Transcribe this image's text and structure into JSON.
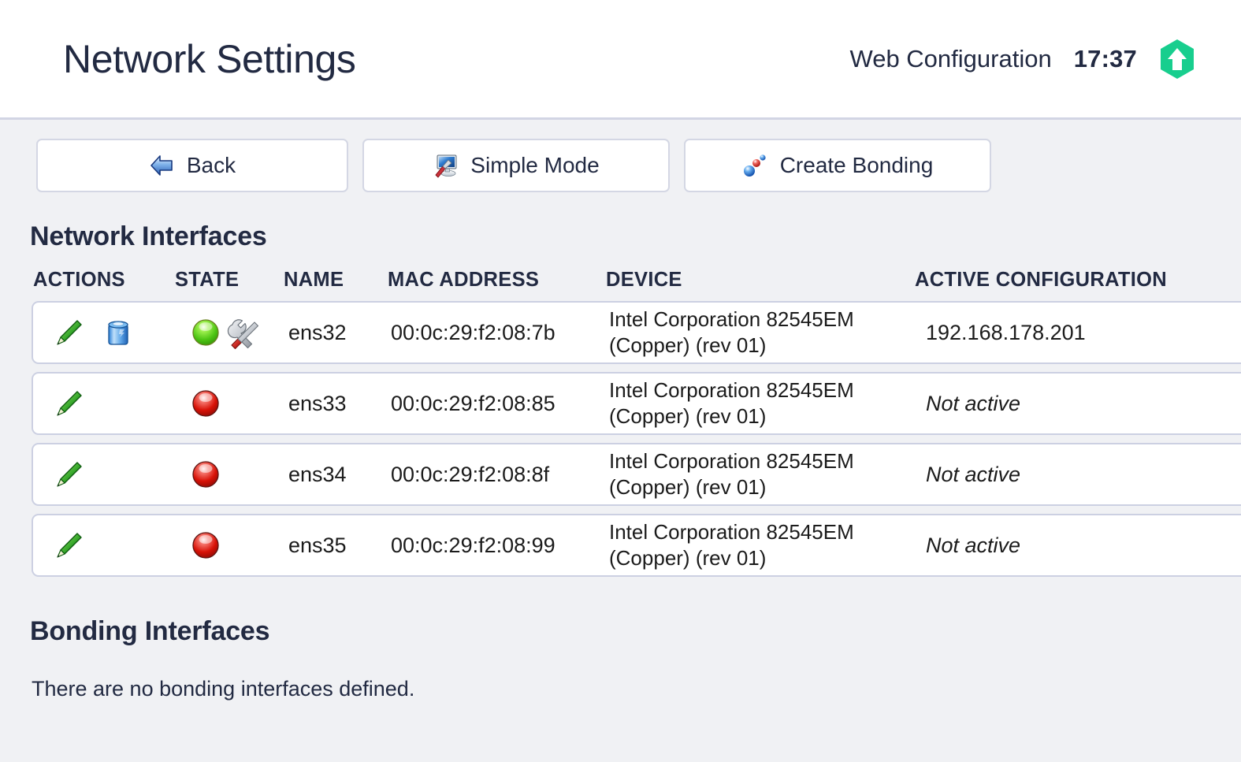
{
  "header": {
    "title": "Network Settings",
    "section": "Web Configuration",
    "clock": "17:37",
    "logo_color": "#18ce8e",
    "logo_icon": "hexagon-up-arrow-logo"
  },
  "toolbar": {
    "buttons": [
      {
        "label": "Back",
        "icon": "back-arrow-icon"
      },
      {
        "label": "Simple Mode",
        "icon": "monitor-screwdriver-icon"
      },
      {
        "label": "Create Bonding",
        "icon": "bonding-spheres-icon"
      }
    ]
  },
  "interfaces_section": {
    "heading": "Network Interfaces",
    "columns": [
      "ACTIONS",
      "STATE",
      "NAME",
      "MAC ADDRESS",
      "DEVICE",
      "ACTIVE CONFIGURATION"
    ],
    "rows": [
      {
        "actions": [
          "edit-pencil-icon",
          "delete-trash-icon"
        ],
        "state": "up",
        "state_icons": [
          "green-led-icon",
          "tools-icon"
        ],
        "name": "ens32",
        "mac": "00:0c:29:f2:08:7b",
        "device": "Intel Corporation 82545EM (Copper) (rev 01)",
        "config": "192.168.178.201",
        "config_active": true
      },
      {
        "actions": [
          "edit-pencil-icon"
        ],
        "state": "down",
        "state_icons": [
          "red-led-icon"
        ],
        "name": "ens33",
        "mac": "00:0c:29:f2:08:85",
        "device": "Intel Corporation 82545EM (Copper) (rev 01)",
        "config": "Not active",
        "config_active": false
      },
      {
        "actions": [
          "edit-pencil-icon"
        ],
        "state": "down",
        "state_icons": [
          "red-led-icon"
        ],
        "name": "ens34",
        "mac": "00:0c:29:f2:08:8f",
        "device": "Intel Corporation 82545EM (Copper) (rev 01)",
        "config": "Not active",
        "config_active": false
      },
      {
        "actions": [
          "edit-pencil-icon"
        ],
        "state": "down",
        "state_icons": [
          "red-led-icon"
        ],
        "name": "ens35",
        "mac": "00:0c:29:f2:08:99",
        "device": "Intel Corporation 82545EM (Copper) (rev 01)",
        "config": "Not active",
        "config_active": false
      }
    ]
  },
  "bonding_section": {
    "heading": "Bonding Interfaces",
    "empty_message": "There are no bonding interfaces defined."
  },
  "colors": {
    "page_background": "#f0f1f4",
    "card_background": "#ffffff",
    "card_border": "#ccd0e2",
    "text": "#222a42",
    "accent_green": "#18ce8e",
    "led_green": "#5dd21a",
    "led_red": "#e01313"
  }
}
